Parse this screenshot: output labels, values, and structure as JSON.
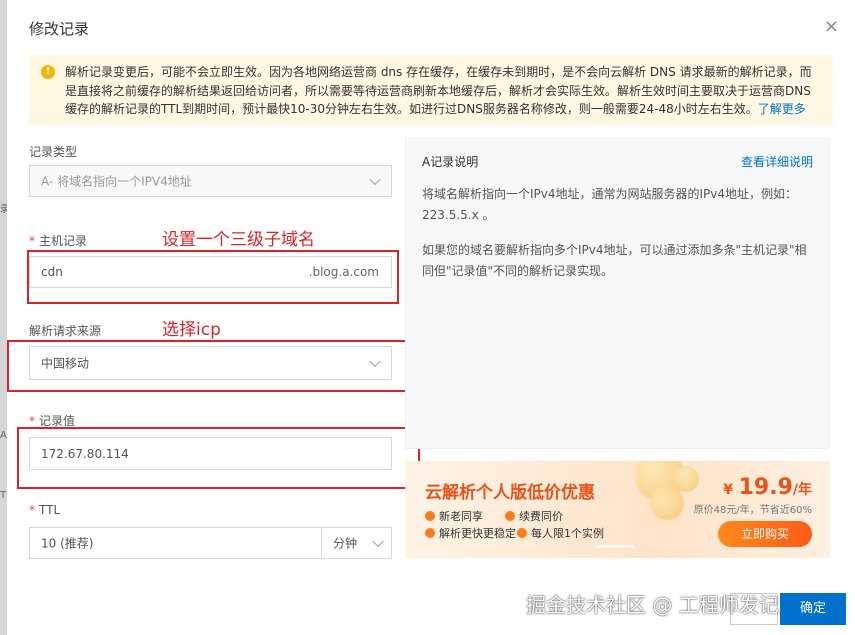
{
  "dialog": {
    "title": "修改记录",
    "close_glyph": "×"
  },
  "notice": {
    "icon": "warning-icon",
    "text": "解析记录变更后，可能不会立即生效。因为各地网络运营商 dns 存在缓存，在缓存未到期时，是不会向云解析 DNS 请求最新的解析记录，而是直接将之前缓存的解析结果返回给访问者，所以需要等待运营商刷新本地缓存后，解析才会实际生效。解析生效时间主要取决于运营商DNS缓存的解析记录的TTL到期时间，预计最快10-30分钟左右生效。如进行过DNS服务器名称修改，则一般需要24-48小时左右生效。",
    "link": "了解更多"
  },
  "form": {
    "record_type": {
      "label": "记录类型",
      "value": "A- 将域名指向一个IPV4地址"
    },
    "host": {
      "label": "主机记录",
      "required_mark": "*",
      "value": "cdn",
      "suffix": ".blog.a.com"
    },
    "source": {
      "label": "解析请求来源",
      "value": "中国移动"
    },
    "record_value": {
      "label": "记录值",
      "required_mark": "*",
      "value": "172.67.80.114"
    },
    "ttl": {
      "label": "TTL",
      "required_mark": "*",
      "value": "10 (推荐)",
      "unit": "分钟"
    }
  },
  "annotations": {
    "subdomain": "设置一个三级子域名",
    "icp": "选择icp"
  },
  "info": {
    "title": "A记录说明",
    "link": "查看详细说明",
    "para1": "将域名解析指向一个IPv4地址，通常为网站服务器的IPv4地址，例如：",
    "example": "223.5.5.x 。",
    "para2": "如果您的域名要解析指向多个IPv4地址，可以通过添加多条\"主机记录\"相同但\"记录值\"不同的解析记录实现。"
  },
  "promo": {
    "title": "云解析个人版低价优惠",
    "features": [
      "新老同享",
      "续费同价",
      "解析更快更稳定",
      "每人限1个实例"
    ],
    "price_currency": "¥",
    "price": "19.9",
    "price_unit": "/年",
    "original": "原价48元/年，节省近60%",
    "buy": "立即购买"
  },
  "footer": {
    "ok": "确定"
  },
  "watermark": "掘金技术社区 @ 工程师发记",
  "colors": {
    "accent": "#0070cc",
    "annotation": "#d8242c",
    "promo": "#e8531c"
  }
}
